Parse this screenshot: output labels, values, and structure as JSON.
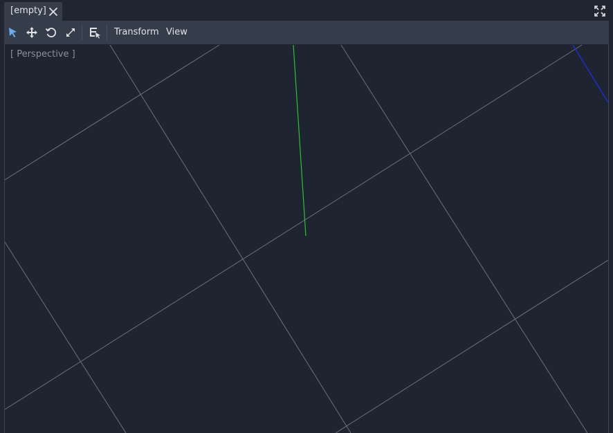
{
  "tab": {
    "label": "[empty]",
    "close_icon": "close-icon"
  },
  "window": {
    "fullscreen_icon": "fullscreen-icon"
  },
  "toolbar": {
    "tools": [
      {
        "name": "select-tool",
        "icon": "select-arrow-icon",
        "active": true
      },
      {
        "name": "move-tool",
        "icon": "move-icon",
        "active": false
      },
      {
        "name": "rotate-tool",
        "icon": "rotate-icon",
        "active": false
      },
      {
        "name": "scale-tool",
        "icon": "scale-icon",
        "active": false
      },
      {
        "name": "list-select-tool",
        "icon": "list-select-icon",
        "active": false
      }
    ],
    "transform_label": "Transform",
    "view_label": "View"
  },
  "viewport": {
    "label": "[ Perspective ]",
    "colors": {
      "background": "#1e2530",
      "grid": "#7a808a",
      "y_axis": "#2ec22e",
      "z_axis": "#1e2fc8"
    }
  }
}
